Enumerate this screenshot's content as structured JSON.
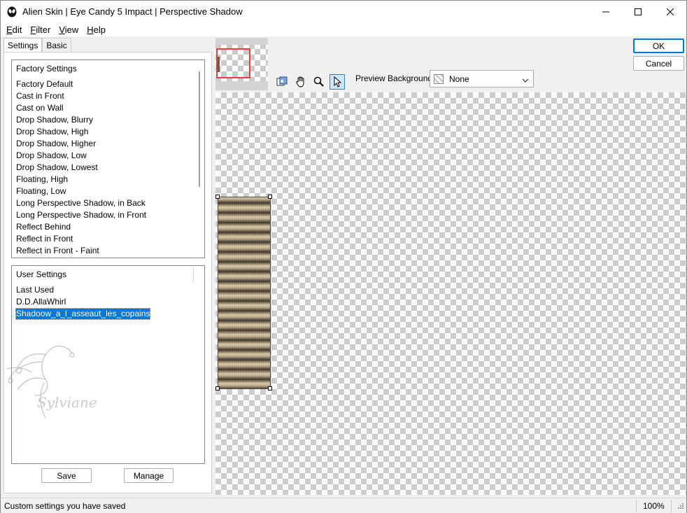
{
  "window": {
    "title": "Alien Skin | Eye Candy 5 Impact | Perspective Shadow"
  },
  "menu": {
    "items": [
      {
        "key": "E",
        "rest": "dit"
      },
      {
        "key": "F",
        "rest": "ilter"
      },
      {
        "key": "V",
        "rest": "iew"
      },
      {
        "key": "H",
        "rest": "elp"
      }
    ]
  },
  "tabs": [
    "Settings",
    "Basic"
  ],
  "factory_settings": {
    "header": "Factory Settings",
    "items": [
      "Factory Default",
      "Cast in Front",
      "Cast on Wall",
      "Drop Shadow, Blurry",
      "Drop Shadow, High",
      "Drop Shadow, Higher",
      "Drop Shadow, Low",
      "Drop Shadow, Lowest",
      "Floating, High",
      "Floating, Low",
      "Long Perspective Shadow, in Back",
      "Long Perspective Shadow, in Front",
      "Reflect Behind",
      "Reflect in Front",
      "Reflect in Front - Faint"
    ]
  },
  "user_settings": {
    "header": "User Settings",
    "items": [
      "Last Used",
      "D.D.AllaWhirl",
      "Shadoow_a_l_asseaut_les_copains"
    ],
    "selected_index": 2
  },
  "buttons": {
    "save": "Save",
    "manage": "Manage",
    "ok": "OK",
    "cancel": "Cancel"
  },
  "preview": {
    "background_label": "Preview Background:",
    "background_value": "None"
  },
  "status": {
    "text": "Custom settings you have saved",
    "zoom": "100%"
  },
  "watermark": {
    "text": "Sylviane"
  },
  "colors": {
    "accent": "#0078d7",
    "nav_rect": "#e84040"
  }
}
